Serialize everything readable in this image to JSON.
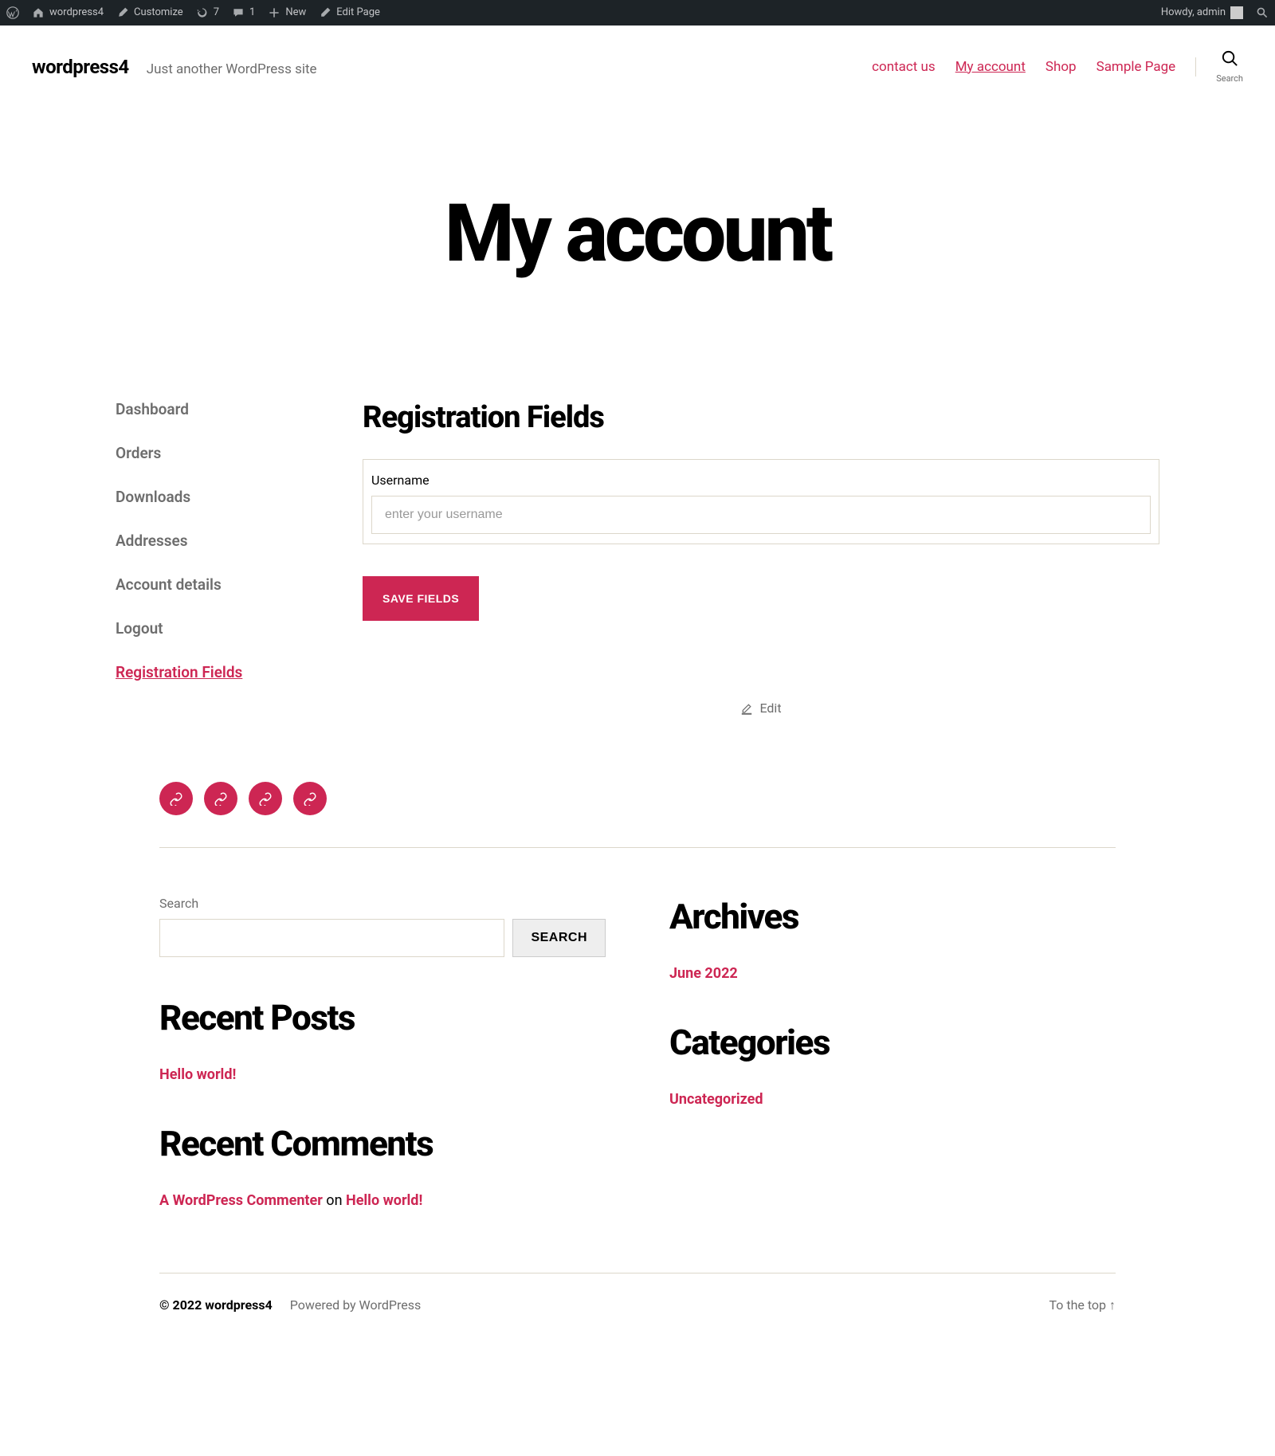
{
  "adminbar": {
    "site_name": "wordpress4",
    "customize": "Customize",
    "updates": "7",
    "comments": "1",
    "new": "New",
    "edit_page": "Edit Page",
    "howdy": "Howdy, admin"
  },
  "header": {
    "site_title": "wordpress4",
    "tagline": "Just another WordPress site",
    "nav": [
      {
        "label": "contact us",
        "current": false
      },
      {
        "label": "My account",
        "current": true
      },
      {
        "label": "Shop",
        "current": false
      },
      {
        "label": "Sample Page",
        "current": false
      }
    ],
    "search_label": "Search"
  },
  "page": {
    "title": "My account"
  },
  "account_nav": [
    {
      "label": "Dashboard",
      "active": false
    },
    {
      "label": "Orders",
      "active": false
    },
    {
      "label": "Downloads",
      "active": false
    },
    {
      "label": "Addresses",
      "active": false
    },
    {
      "label": "Account details",
      "active": false
    },
    {
      "label": "Logout",
      "active": false
    },
    {
      "label": "Registration Fields",
      "active": true
    }
  ],
  "registration": {
    "heading": "Registration Fields",
    "field_label": "Username",
    "field_placeholder": "enter your username",
    "field_value": "",
    "save_button": "SAVE FIELDS"
  },
  "edit_link": "Edit",
  "footer": {
    "search_label": "Search",
    "search_button": "SEARCH",
    "recent_posts_title": "Recent Posts",
    "recent_posts": [
      "Hello world!"
    ],
    "recent_comments_title": "Recent Comments",
    "recent_comments": [
      {
        "author": "A WordPress Commenter",
        "on": "on",
        "post": "Hello world!"
      }
    ],
    "archives_title": "Archives",
    "archives": [
      "June 2022"
    ],
    "categories_title": "Categories",
    "categories": [
      "Uncategorized"
    ]
  },
  "bottom": {
    "copyright": "© 2022 wordpress4",
    "powered": "Powered by WordPress",
    "to_top": "To the top ↑"
  }
}
